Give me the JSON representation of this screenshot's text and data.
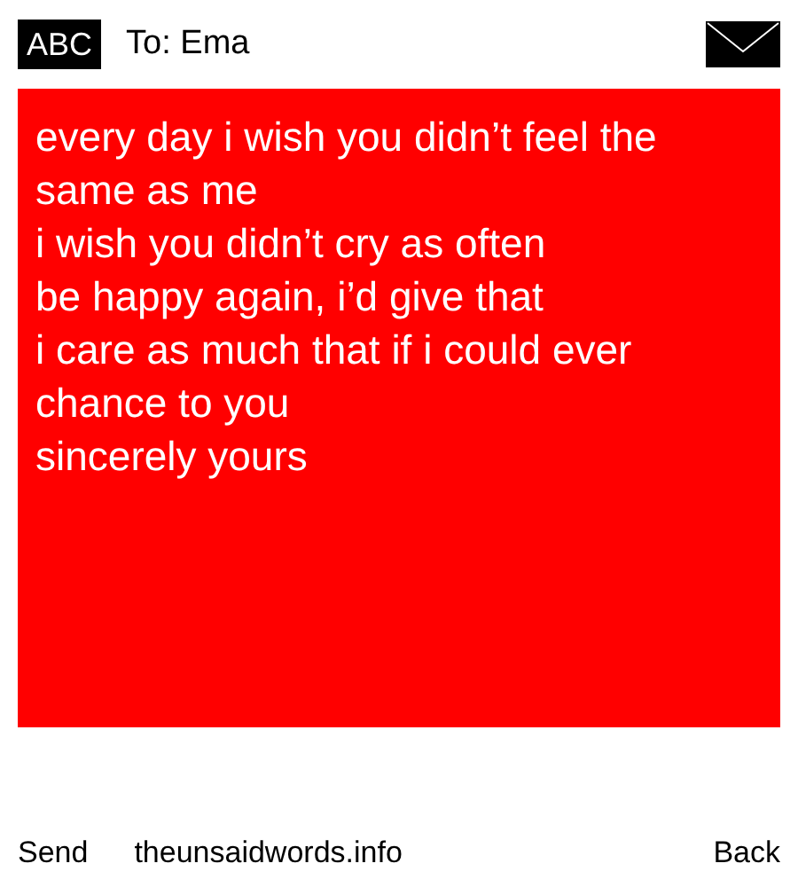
{
  "header": {
    "keyboard_label": "ABC",
    "recipient": "To: Ema"
  },
  "message": {
    "lines": [
      "every day i wish you didn’t feel the same as me",
      "i wish you didn’t cry as often",
      "be happy again, i’d give that",
      "i care as much that if i could ever",
      "chance to you",
      "sincerely yours"
    ]
  },
  "footer": {
    "send": "Send",
    "site": "theunsaidwords.info",
    "back": "Back"
  }
}
